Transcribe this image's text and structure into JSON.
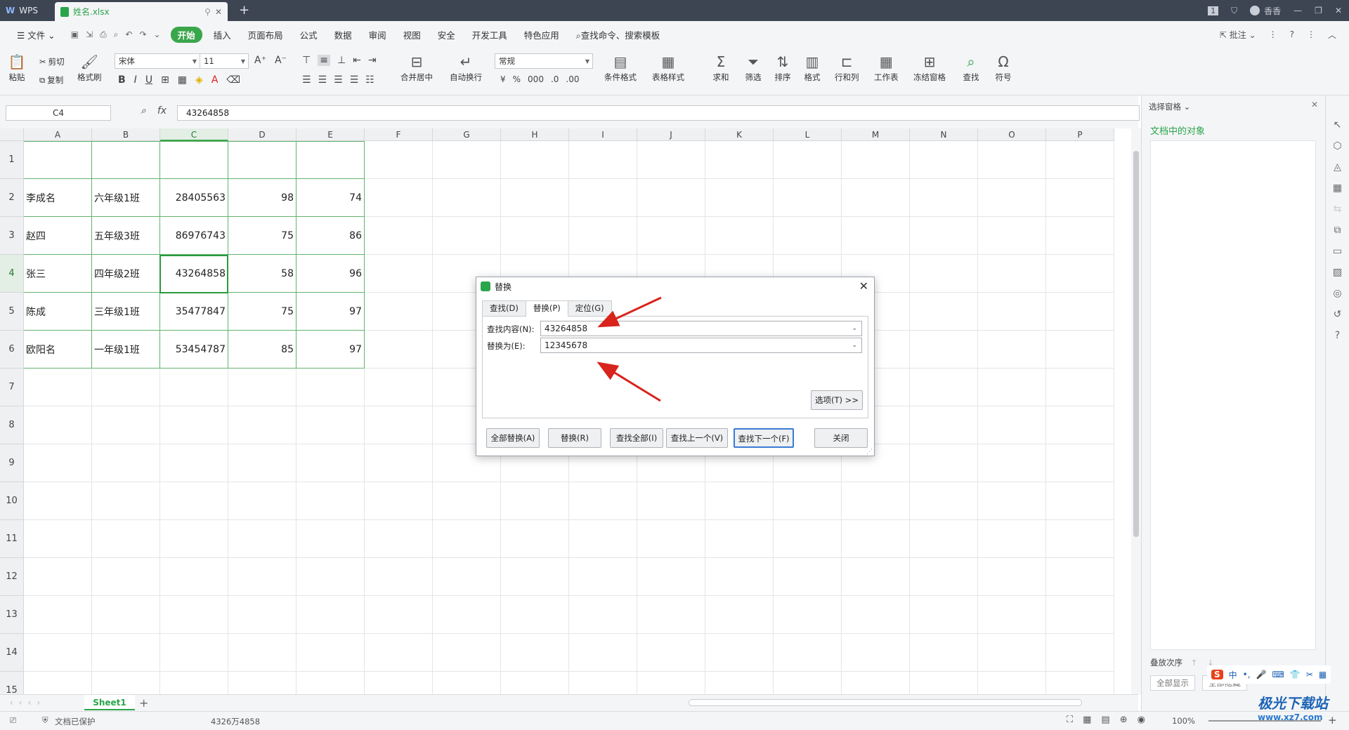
{
  "titlebar": {
    "app_tab": "WPS",
    "file_tab": "姓名.xlsx",
    "new_tab": "+",
    "page_badge": "1",
    "user": "香香"
  },
  "menubar": {
    "file": "文件",
    "items": [
      "开始",
      "插入",
      "页面布局",
      "公式",
      "数据",
      "审阅",
      "视图",
      "安全",
      "开发工具",
      "特色应用"
    ],
    "search": "查找命令、搜索模板",
    "comment": "批注"
  },
  "ribbon": {
    "paste": "粘贴",
    "cut": "剪切",
    "copy": "复制",
    "format_painter": "格式刷",
    "font_name": "宋体",
    "font_size": "11",
    "merge": "合并居中",
    "wrap": "自动换行",
    "number_format": "常规",
    "conditional": "条件格式",
    "table_style": "表格样式",
    "sum": "求和",
    "filter": "筛选",
    "sort": "排序",
    "format": "格式",
    "rowcol": "行和列",
    "sheet": "工作表",
    "freeze": "冻结窗格",
    "find": "查找",
    "symbol": "符号"
  },
  "formula": {
    "name_box": "C4",
    "fx": "fx",
    "value": "43264858"
  },
  "columns": [
    "A",
    "B",
    "C",
    "D",
    "E",
    "F",
    "G",
    "H",
    "I",
    "J",
    "K",
    "L",
    "M",
    "N",
    "O",
    "P"
  ],
  "rows": [
    "1",
    "2",
    "3",
    "4",
    "5",
    "6",
    "7",
    "8",
    "9",
    "10",
    "11",
    "12",
    "13",
    "14",
    "15"
  ],
  "table": [
    [
      "李成名",
      "六年级1班",
      "28405563",
      "98",
      "74"
    ],
    [
      "赵四",
      "五年级3班",
      "86976743",
      "75",
      "86"
    ],
    [
      "张三",
      "四年级2班",
      "43264858",
      "58",
      "96"
    ],
    [
      "陈成",
      "三年级1班",
      "35477847",
      "75",
      "97"
    ],
    [
      "欧阳名",
      "一年级1班",
      "53454787",
      "85",
      "97"
    ]
  ],
  "sheet_tab": "Sheet1",
  "status": {
    "protected": "文档已保护",
    "value": "4326万4858",
    "zoom": "100%"
  },
  "pane": {
    "title": "选择窗格",
    "subtitle": "文档中的对象",
    "order": "叠放次序",
    "show_all": "全部显示",
    "hide_all": "全部隐藏"
  },
  "dialog": {
    "title": "替换",
    "tabs": [
      "查找(D)",
      "替换(P)",
      "定位(G)"
    ],
    "find_label": "查找内容(N):",
    "find_value": "43264858",
    "replace_label": "替换为(E):",
    "replace_value": "12345678",
    "options": "选项(T) >>",
    "buttons": [
      "全部替换(A)",
      "替换(R)",
      "查找全部(I)",
      "查找上一个(V)",
      "查找下一个(F)",
      "关闭"
    ]
  },
  "watermark": {
    "brand": "极光下载站",
    "url": "www.xz7.com"
  }
}
